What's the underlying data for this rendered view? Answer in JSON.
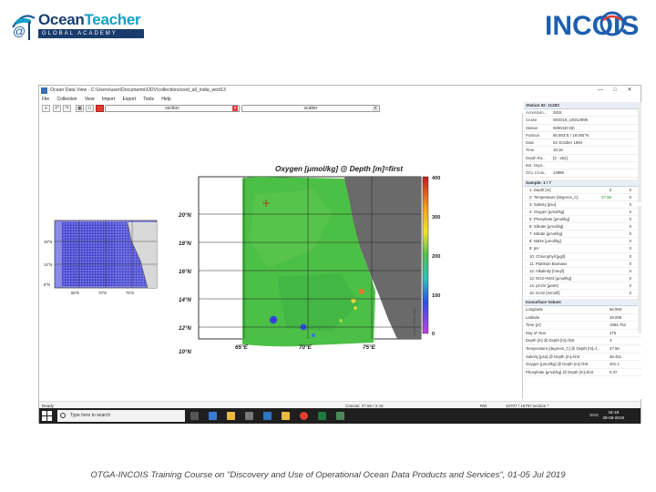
{
  "logo": {
    "at": "@",
    "ocean": "Ocean",
    "teacher": "Teacher",
    "academy": "GLOBAL ACADEMY",
    "incois": "INCOIS"
  },
  "window": {
    "title": "Ocean Data View - C:\\Users\\user\\Documents\\ODV\\collections\\ood_all_india_wod13",
    "controls": [
      "—",
      "□",
      "✕"
    ]
  },
  "menu": [
    "File",
    "Collection",
    "View",
    "Import",
    "Export",
    "Tools",
    "Help"
  ],
  "tabs": [
    "section",
    "scatter"
  ],
  "map": {
    "title": "Oxygen [μmol/kg] @ Depth [m]=first",
    "lat_ticks": [
      "20°N",
      "18°N",
      "16°N",
      "14°N",
      "12°N",
      "10°N"
    ],
    "lon_ticks": [
      "65°E",
      "70°E",
      "75°E"
    ],
    "colorbar_ticks": [
      "400",
      "300",
      "200",
      "100",
      "0"
    ],
    "side_label": "Ocean Data View"
  },
  "minimap": {
    "lat_ticks": [
      "19°N",
      "14°N",
      "9°N"
    ],
    "lon_ticks": [
      "65°E",
      "70°E",
      "75°E"
    ]
  },
  "station": {
    "header": "Station ID: 11283",
    "rows": [
      {
        "k": "Accession...",
        "v": "2815"
      },
      {
        "k": "Cruise",
        "v": "WOD18_US013995"
      },
      {
        "k": "Station",
        "v": "9290420 (B)"
      },
      {
        "k": "Position",
        "v": "66.993°E / 19.005°N"
      },
      {
        "k": "Date",
        "v": "02 October 1994"
      },
      {
        "k": "Time",
        "v": "15:16"
      },
      {
        "k": "Depth Ra...",
        "v": "[3 - 252]"
      },
      {
        "k": "Bot. Dept...",
        "v": ""
      },
      {
        "k": "OCL Cruis...",
        "v": "13995"
      }
    ]
  },
  "samples": {
    "header": "Sample: 1 / 7",
    "rows": [
      {
        "n": "1: Depth [m]",
        "a": "3",
        "b": "0"
      },
      {
        "n": "2: Temperature [degrees_C]",
        "a": "27.56",
        "b": "0"
      },
      {
        "n": "3: Salinity [psu]",
        "a": "",
        "b": "0"
      },
      {
        "n": "4: Oxygen [μmol/kg]",
        "a": "",
        "b": "0"
      },
      {
        "n": "5: Phosphate [μmol/kg]",
        "a": "",
        "b": "0"
      },
      {
        "n": "6: Silicate [μmol/kg]",
        "a": "",
        "b": "0"
      },
      {
        "n": "7: Nitrate [μmol/kg]",
        "a": "",
        "b": "0"
      },
      {
        "n": "8: Nitrite [μmol/kg]",
        "a": "",
        "b": "0"
      },
      {
        "n": "9: pH",
        "a": "",
        "b": "0"
      },
      {
        "n": "10: Chlorophyll [μg/l]",
        "a": "",
        "b": "0"
      },
      {
        "n": "11: Plankton Biomass",
        "a": "",
        "b": "0"
      },
      {
        "n": "12: Alkalinity [meq/l]",
        "a": "",
        "b": "0"
      },
      {
        "n": "13: NO2+NO3 [μmol/kg]",
        "a": "",
        "b": "0"
      },
      {
        "n": "14: pCO2 [μatm]",
        "a": "",
        "b": "0"
      },
      {
        "n": "15: tCO2 [mmol/l]",
        "a": "",
        "b": "0"
      }
    ]
  },
  "isosurface": {
    "header": "Isosurface Values",
    "rows": [
      {
        "k": "Longitude",
        "v": "66.993"
      },
      {
        "k": "Latitude",
        "v": "19.005"
      },
      {
        "k": "Time [yr]",
        "v": "1994.752"
      },
      {
        "k": "Day of Year",
        "v": "275"
      },
      {
        "k": "Depth [m] @ Depth [m]=first",
        "v": "3"
      },
      {
        "k": "Temperature [degrees_C] @ Depth [m]=f...",
        "v": "27.56"
      },
      {
        "k": "Salinity [psu] @ Depth [m]=first",
        "v": "36.451"
      },
      {
        "k": "Oxygen [μmol/kg] @ Depth [m]=first",
        "v": "201.1"
      },
      {
        "k": "Phosphate [μmol/kg] @ Depth [m]=first",
        "v": "0.37"
      }
    ]
  },
  "status": {
    "left": "Ready",
    "canvas": "Canvas: 27.56 / 2.43",
    "rw": "RW",
    "count": "16707 / 16707 section *"
  },
  "taskbar": {
    "search_placeholder": "Type here to search",
    "tray": "ENG",
    "time": "18:18",
    "date": "29-06-2019"
  },
  "footer": "OTGA-INCOIS Training Course on \"Discovery and Use of Operational Ocean Data Products and Services\", 01-05 Jul 2019"
}
